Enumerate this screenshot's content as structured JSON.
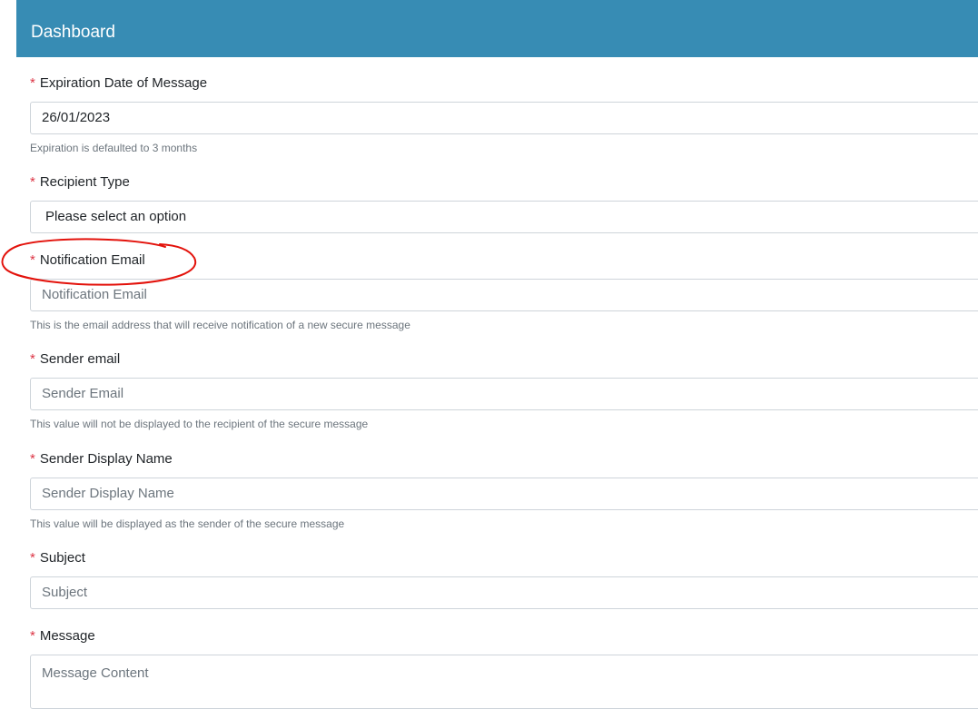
{
  "header": {
    "title": "Dashboard"
  },
  "form": {
    "required_marker": "*",
    "expiration": {
      "label": "Expiration Date of Message",
      "value": "26/01/2023",
      "help": "Expiration is defaulted to 3 months"
    },
    "recipient_type": {
      "label": "Recipient Type",
      "selected": "Please select an option"
    },
    "notification_email": {
      "label": "Notification Email",
      "placeholder": "Notification Email",
      "help": "This is the email address that will receive notification of a new secure message"
    },
    "sender_email": {
      "label": "Sender email",
      "placeholder": "Sender Email",
      "help": "This value will not be displayed to the recipient of the secure message"
    },
    "sender_display_name": {
      "label": "Sender Display Name",
      "placeholder": "Sender Display Name",
      "help": "This value will be displayed as the sender of the secure message"
    },
    "subject": {
      "label": "Subject",
      "placeholder": "Subject"
    },
    "message": {
      "label": "Message",
      "placeholder": "Message Content"
    }
  },
  "colors": {
    "header_bg": "#378cb4",
    "required": "#dc3545",
    "annotation": "#e3120b"
  }
}
